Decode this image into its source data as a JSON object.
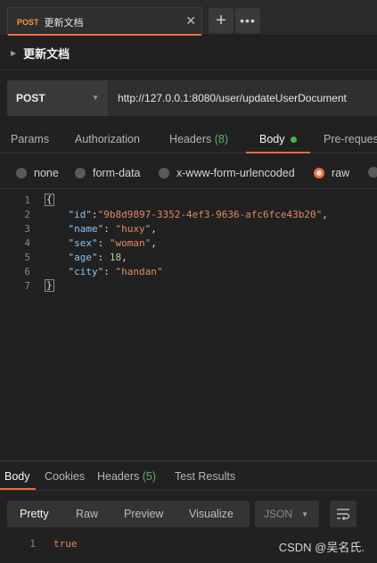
{
  "tab": {
    "method": "POST",
    "name": "更新文档",
    "close_glyph": "✕"
  },
  "tab_actions": {
    "add_glyph": "+",
    "more_glyph": "•••"
  },
  "request": {
    "title": "更新文档",
    "method": "POST",
    "url": "http://127.0.0.1:8080/user/updateUserDocument"
  },
  "request_tabs": {
    "params": "Params",
    "authorization": "Authorization",
    "headers": "Headers",
    "headers_count": "(8)",
    "body": "Body",
    "pre_request": "Pre-request"
  },
  "body_types": {
    "none": "none",
    "form_data": "form-data",
    "urlencoded": "x-www-form-urlencoded",
    "raw": "raw",
    "selected": "raw"
  },
  "editor": {
    "line_numbers": [
      "1",
      "2",
      "3",
      "4",
      "5",
      "6",
      "7"
    ],
    "open_brace": "{",
    "close_brace": "}",
    "fields": [
      {
        "key": "\"id\"",
        "value": "\"9b8d9897-3352-4ef3-9636-afc6fce43b20\"",
        "type": "string"
      },
      {
        "key": "\"name\"",
        "value": "\"huxy\"",
        "type": "string"
      },
      {
        "key": "\"sex\"",
        "value": "\"woman\"",
        "type": "string"
      },
      {
        "key": "\"age\"",
        "value": "18",
        "type": "number"
      },
      {
        "key": "\"city\"",
        "value": "\"handan\"",
        "type": "string"
      }
    ]
  },
  "response_tabs": {
    "body": "Body",
    "cookies": "Cookies",
    "headers": "Headers",
    "headers_count": "(5)",
    "test_results": "Test Results"
  },
  "response_view": {
    "pretty": "Pretty",
    "raw": "Raw",
    "preview": "Preview",
    "visualize": "Visualize",
    "format": "JSON"
  },
  "response_body": {
    "line_number": "1",
    "value": "true"
  },
  "watermark": "CSDN @吴名氏.",
  "colors": {
    "accent": "#f26b3a",
    "method_post": "#f29b3a",
    "count_green": "#5fae5f",
    "json_key": "#8fc3ef",
    "json_string": "#e48963"
  }
}
